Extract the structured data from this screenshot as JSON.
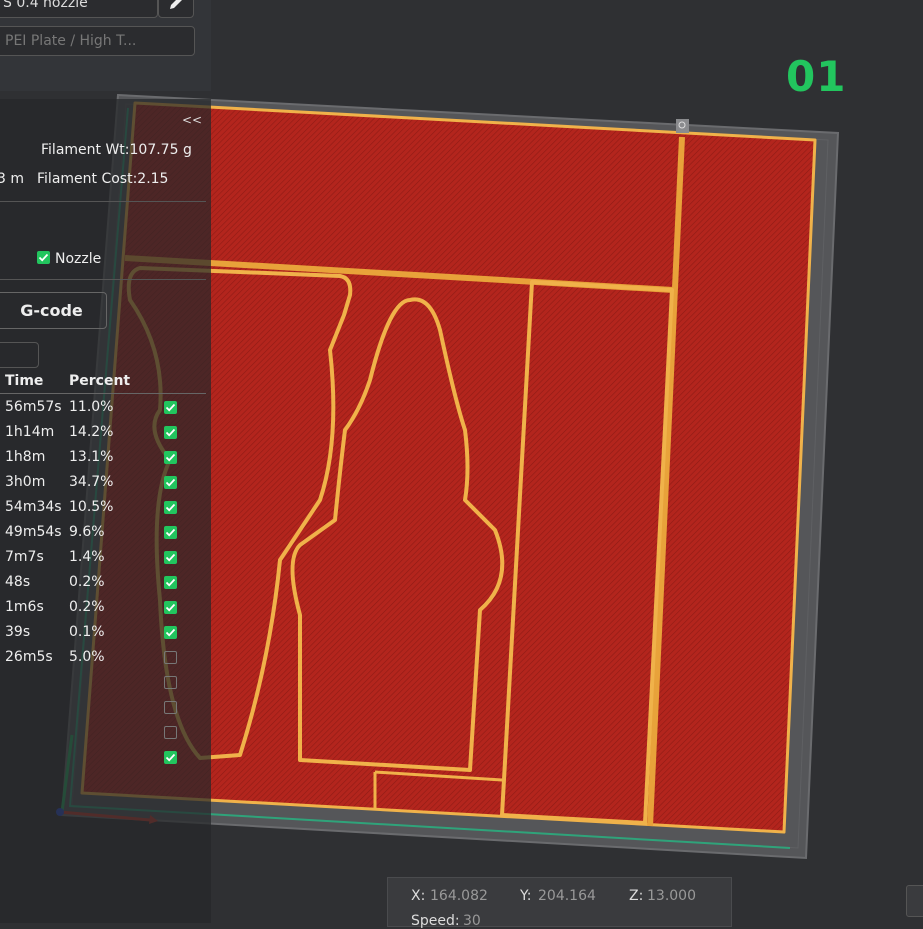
{
  "plate": {
    "number": "01"
  },
  "printer": {
    "nozzle_label": "S 0.4 nozzle",
    "plate_type": "PEI Plate / High T..."
  },
  "panel": {
    "collapse_label": "<<",
    "filament_weight": "Filament Wt:107.75 g",
    "filament_length_fragment": "3 m",
    "filament_cost": "Filament Cost:2.15",
    "nozzle_label": "Nozzle",
    "gcode_button": "G-code"
  },
  "table": {
    "headers": {
      "time": "Time",
      "percent": "Percent"
    },
    "rows": [
      {
        "time": "56m57s",
        "percent": "11.0%",
        "checked": true
      },
      {
        "time": "1h14m",
        "percent": "14.2%",
        "checked": true
      },
      {
        "time": "1h8m",
        "percent": "13.1%",
        "checked": true
      },
      {
        "time": "3h0m",
        "percent": "34.7%",
        "checked": true
      },
      {
        "time": "54m34s",
        "percent": "10.5%",
        "checked": true
      },
      {
        "time": "49m54s",
        "percent": "9.6%",
        "checked": true
      },
      {
        "time": "7m7s",
        "percent": "1.4%",
        "checked": true
      },
      {
        "time": "48s",
        "percent": "0.2%",
        "checked": true
      },
      {
        "time": "1m6s",
        "percent": "0.2%",
        "checked": true
      },
      {
        "time": "39s",
        "percent": "0.1%",
        "checked": true
      },
      {
        "time": "26m5s",
        "percent": "5.0%",
        "checked": false
      },
      {
        "time": "",
        "percent": "",
        "checked": false
      },
      {
        "time": "",
        "percent": "",
        "checked": false
      },
      {
        "time": "",
        "percent": "",
        "checked": false
      },
      {
        "time": "",
        "percent": "",
        "checked": true
      }
    ]
  },
  "coords": {
    "x_label": "X:",
    "x_value": "164.082",
    "y_label": "Y:",
    "y_value": "204.164",
    "z_label": "Z:",
    "z_value": "13.000",
    "speed_label": "Speed:",
    "speed_value": "30"
  },
  "colors": {
    "accent": "#22c55e",
    "infill": "#b3241c",
    "perimeter": "#e8a23a",
    "background": "#2f3033"
  }
}
